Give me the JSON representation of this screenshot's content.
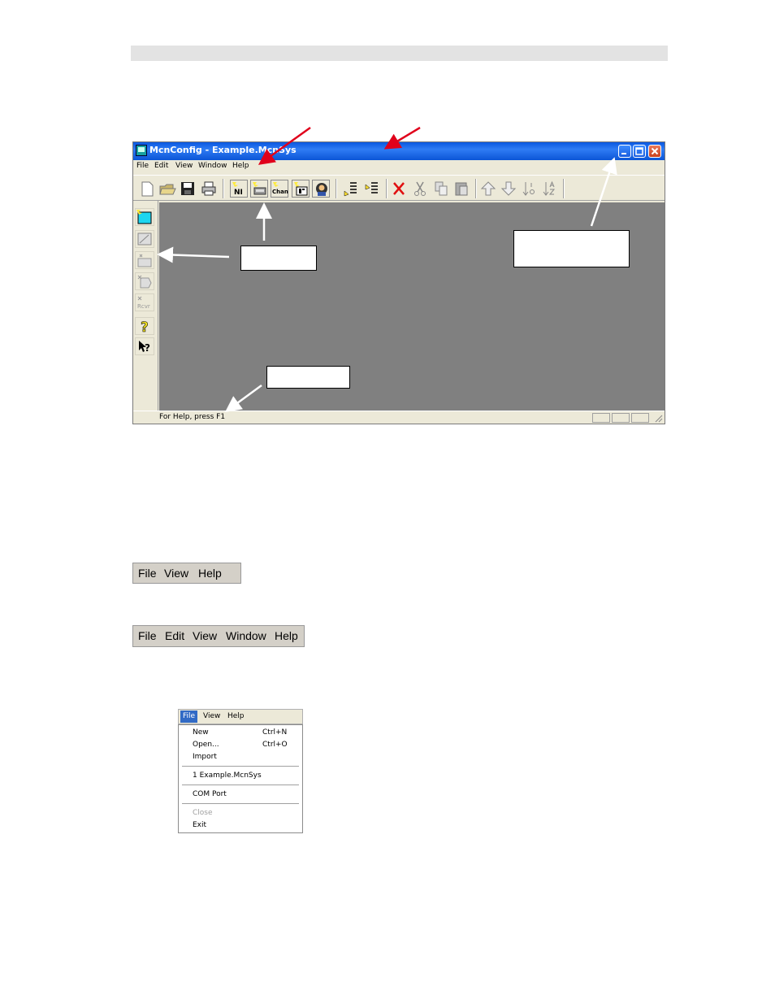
{
  "app": {
    "title": "McnConfig - Example.McnSys",
    "menu": [
      "File",
      "Edit",
      "View",
      "Window",
      "Help"
    ],
    "toolbar_text_buttons": [
      "NI",
      "Chan"
    ],
    "status_text": "For Help, press F1"
  },
  "strip_small": [
    "File",
    "View",
    "Help"
  ],
  "strip_large": [
    "File",
    "Edit",
    "View",
    "Window",
    "Help"
  ],
  "dropdown": {
    "menubar": [
      "File",
      "View",
      "Help"
    ],
    "items": [
      {
        "label": "New",
        "shortcut": "Ctrl+N"
      },
      {
        "label": "Open...",
        "shortcut": "Ctrl+O"
      },
      {
        "label": "Import",
        "shortcut": ""
      },
      {
        "label": "1 Example.McnSys",
        "shortcut": ""
      },
      {
        "label": "COM Port",
        "shortcut": ""
      },
      {
        "label": "Close",
        "shortcut": ""
      },
      {
        "label": "Exit",
        "shortcut": ""
      }
    ]
  },
  "colors": {
    "titlebar": "#0a58e0",
    "client": "#808080",
    "arrow_red": "#e0001b",
    "menu_highlight": "#316ac5"
  }
}
